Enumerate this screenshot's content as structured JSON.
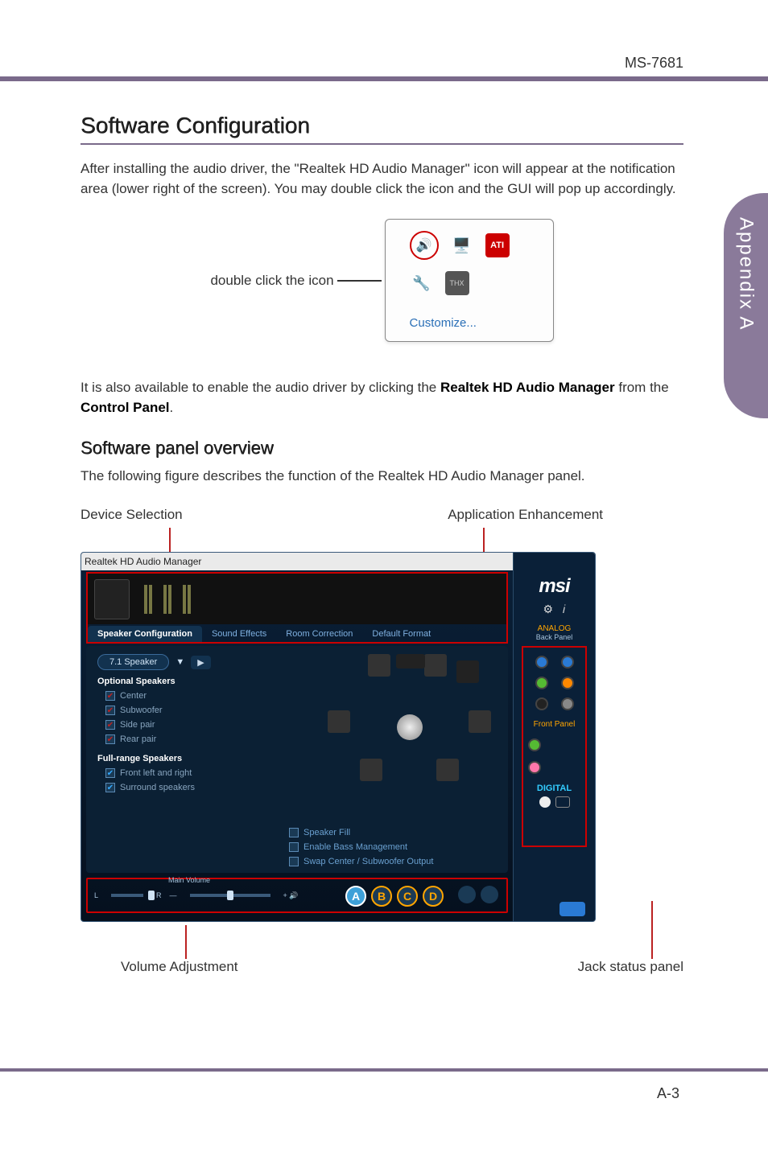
{
  "doc": {
    "id": "MS-7681",
    "sidetab": "Appendix A",
    "page": "A-3"
  },
  "h1": "Software Configuration",
  "p1": "After installing the audio driver, the \"Realtek HD Audio Manager\" icon will appear at the notification area (lower right of the screen). You may double click the icon and the GUI will pop up accordingly.",
  "tray": {
    "label": "double click the icon",
    "customize": "Customize..."
  },
  "p2a": "It is also available to enable the audio driver by clicking the ",
  "p2b": "Realtek HD Audio Manager",
  "p2c": " from the ",
  "p2d": "Control Panel",
  "p2e": ".",
  "h2": "Software panel overview",
  "p3": "The following figure describes the function of the Realtek HD Audio Manager panel.",
  "callouts": {
    "topLeft": "Device Selection",
    "topRight": "Application Enhancement",
    "bottomLeft": "Volume Adjustment",
    "bottomRight": "Jack status panel"
  },
  "panel": {
    "title": "Realtek HD Audio Manager",
    "tabs": {
      "active": "Speaker Configuration",
      "t2": "Sound Effects",
      "t3": "Room Correction",
      "t4": "Default Format"
    },
    "dropdown": "7.1 Speaker",
    "opt_title": "Optional Speakers",
    "opts": {
      "center": "Center",
      "sub": "Subwoofer",
      "side": "Side pair",
      "rear": "Rear pair"
    },
    "fr_title": "Full-range Speakers",
    "fr": {
      "front": "Front left and right",
      "surround": "Surround speakers"
    },
    "bopts": {
      "fill": "Speaker Fill",
      "bass": "Enable Bass Management",
      "swap": "Swap Center / Subwoofer Output"
    },
    "main_volume": "Main Volume",
    "balance": {
      "l": "L",
      "r": "R"
    },
    "right": {
      "brand": "msi",
      "analog": "ANALOG",
      "backpanel": "Back Panel",
      "frontpanel": "Front Panel",
      "digital": "DIGITAL"
    },
    "badges": {
      "a": "A",
      "b": "B",
      "c": "C",
      "d": "D"
    }
  }
}
